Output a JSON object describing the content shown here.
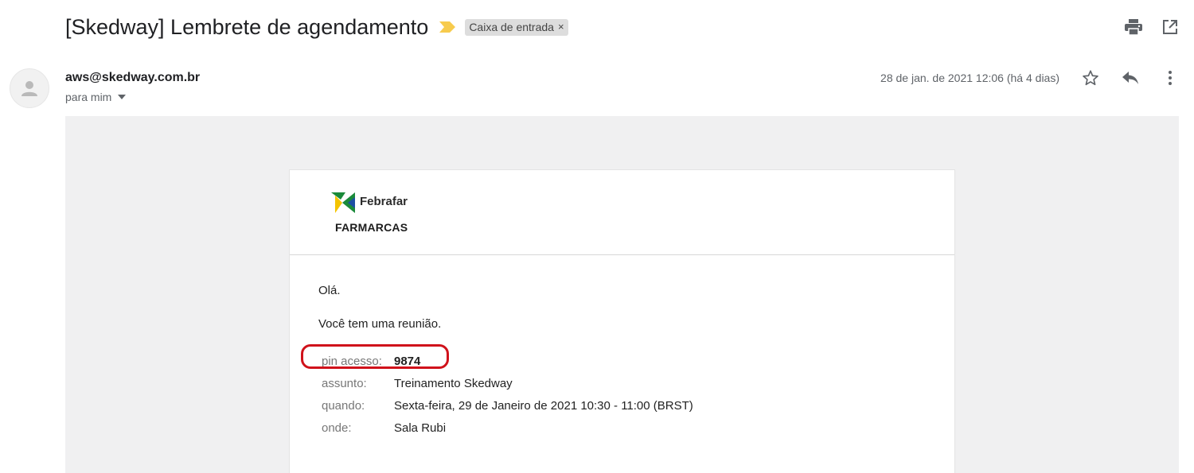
{
  "email": {
    "subject": "[Skedway] Lembrete de agendamento",
    "label": "Caixa de entrada",
    "label_remove": "×",
    "sender": "aws@skedway.com.br",
    "recipient": "para mim",
    "date": "28 de jan. de 2021 12:06 (há 4 dias)"
  },
  "icons": {
    "importance": "importance-marker-icon",
    "print": "print-icon",
    "open_new_window": "open-in-new-icon",
    "star": "star-icon",
    "reply": "reply-icon",
    "more": "more-vert-icon",
    "avatar": "person-icon"
  },
  "colors": {
    "importance": "#f7cb4d",
    "highlight": "#d0121b",
    "logo_green": "#1a8a3a",
    "logo_yellow": "#f4c400",
    "logo_blue": "#1d4fa3"
  },
  "body": {
    "logo_top": "Febrafar",
    "logo_bottom": "FARMARCAS",
    "greeting": "Olá.",
    "intro": "Você tem uma reunião.",
    "details": [
      {
        "label": "pin acesso:",
        "value": "9874"
      },
      {
        "label": "assunto:",
        "value": "Treinamento Skedway"
      },
      {
        "label": "quando:",
        "value": "Sexta-feira, 29 de Janeiro de 2021 10:30 - 11:00 (BRST)"
      },
      {
        "label": "onde:",
        "value": "Sala Rubi"
      }
    ]
  }
}
